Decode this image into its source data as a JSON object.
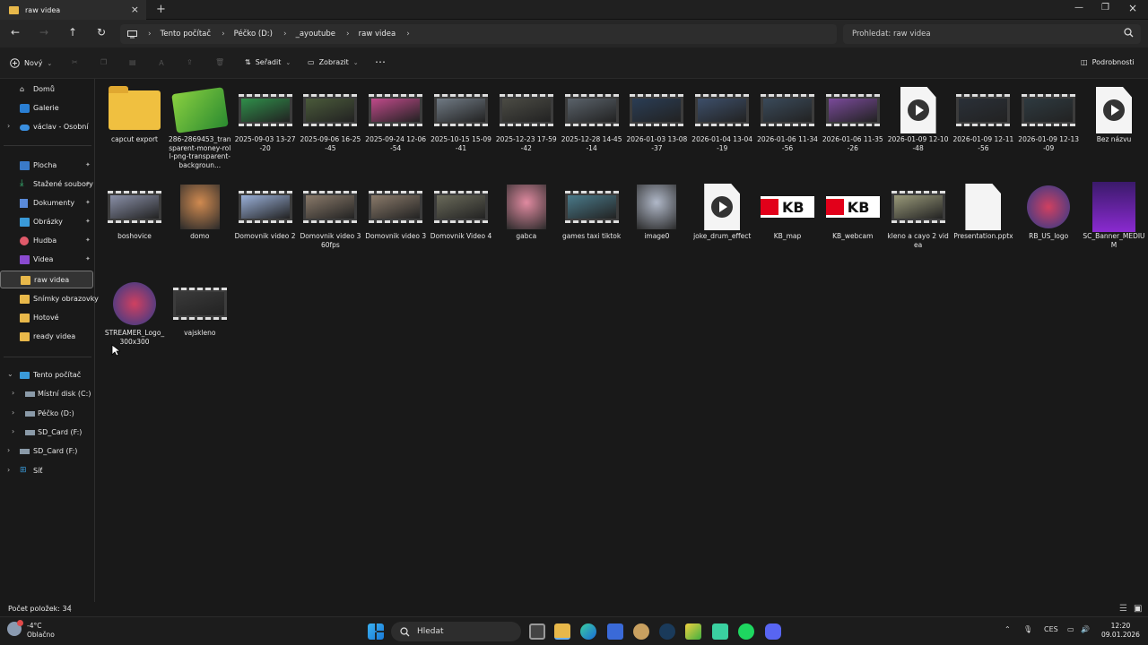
{
  "window": {
    "tab_title": "raw videa"
  },
  "address": {
    "crumbs": [
      "Tento počítač",
      "Péčko (D:)",
      "_ayoutube",
      "raw videa"
    ]
  },
  "search": {
    "placeholder": "Prohledat: raw videa"
  },
  "toolbar": {
    "new_label": "Nový",
    "sort_label": "Seřadit",
    "view_label": "Zobrazit",
    "details_label": "Podrobnosti"
  },
  "sidebar": {
    "home": "Domů",
    "gallery": "Galerie",
    "personal": "václav - Osobní",
    "quick": [
      "Plocha",
      "Stažené soubory",
      "Dokumenty",
      "Obrázky",
      "Hudba",
      "Videa",
      "raw videa",
      "Snímky obrazovky",
      "Hotové",
      "ready videa"
    ],
    "this_pc": "Tento počítač",
    "drives": [
      "Místní disk (C:)",
      "Péčko (D:)",
      "SD_Card (F:)"
    ],
    "sdcard": "SD_Card (F:)",
    "network": "Síť"
  },
  "files": [
    {
      "name": "capcut export",
      "kind": "folder"
    },
    {
      "name": "286-2869453_transparent-money-roll-png-transparent-backgroun...",
      "kind": "image-money"
    },
    {
      "name": "2025-09-03 13-27-20",
      "kind": "video",
      "color": "#2f8f4a"
    },
    {
      "name": "2025-09-06 16-25-45",
      "kind": "video",
      "color": "#4a5a3a"
    },
    {
      "name": "2025-09-24 12-06-54",
      "kind": "video",
      "color": "#c04a8a"
    },
    {
      "name": "2025-10-15 15-09-41",
      "kind": "video",
      "color": "#707a84"
    },
    {
      "name": "2025-12-23 17-59-42",
      "kind": "video",
      "color": "#4b4b44"
    },
    {
      "name": "2025-12-28 14-45-14",
      "kind": "video",
      "color": "#5a626a"
    },
    {
      "name": "2026-01-03 13-08-37",
      "kind": "video",
      "color": "#2a3d55"
    },
    {
      "name": "2026-01-04 13-04-19",
      "kind": "video",
      "color": "#3d4f6a"
    },
    {
      "name": "2026-01-06 11-34-56",
      "kind": "video",
      "color": "#3a4a5a"
    },
    {
      "name": "2026-01-06 11-35-26",
      "kind": "video",
      "color": "#7a4a9a"
    },
    {
      "name": "2026-01-09 12-10-48",
      "kind": "media"
    },
    {
      "name": "2026-01-09 12-11-56",
      "kind": "video",
      "color": "#2a3038"
    },
    {
      "name": "2026-01-09 12-13-09",
      "kind": "video",
      "color": "#2e3a40"
    },
    {
      "name": "Bez názvu",
      "kind": "media"
    },
    {
      "name": "boshovice",
      "kind": "video",
      "color": "#8a90a8"
    },
    {
      "name": "domo",
      "kind": "face",
      "color": "#d08a50"
    },
    {
      "name": "Domovnik video 2",
      "kind": "video",
      "color": "#9ab0d8"
    },
    {
      "name": "Domovnik video 3 60fps",
      "kind": "video",
      "color": "#8a7a6a"
    },
    {
      "name": "Domovnik video 3",
      "kind": "video",
      "color": "#8a7a6a"
    },
    {
      "name": "Domovnik Video 4",
      "kind": "video",
      "color": "#6a6a5a"
    },
    {
      "name": "gabca",
      "kind": "face",
      "color": "#e08aa0"
    },
    {
      "name": "games taxi tiktok",
      "kind": "video",
      "color": "#4a7a8a"
    },
    {
      "name": "image0",
      "kind": "face",
      "color": "#b0b8c8"
    },
    {
      "name": "joke_drum_effect",
      "kind": "media"
    },
    {
      "name": "KB_map",
      "kind": "kb"
    },
    {
      "name": "KB_webcam",
      "kind": "kb"
    },
    {
      "name": "kleno a cayo 2 videa",
      "kind": "video",
      "color": "#9a9a7a"
    },
    {
      "name": "Presentation.pptx",
      "kind": "doc"
    },
    {
      "name": "RB_US_logo",
      "kind": "logo"
    },
    {
      "name": "SC_Banner_MEDIUM",
      "kind": "banner"
    },
    {
      "name": "STREAMER_Logo_300x300",
      "kind": "logo"
    },
    {
      "name": "vajskleno",
      "kind": "video",
      "color": "#3a3a3a"
    }
  ],
  "kb_text": "KB",
  "status": {
    "count_label": "Počet položek: 34"
  },
  "taskbar": {
    "weather_temp": "-4°C",
    "weather_desc": "Oblačno",
    "search_label": "Hledat",
    "lang": "CES",
    "time": "12:20",
    "date": "09.01.2026"
  }
}
